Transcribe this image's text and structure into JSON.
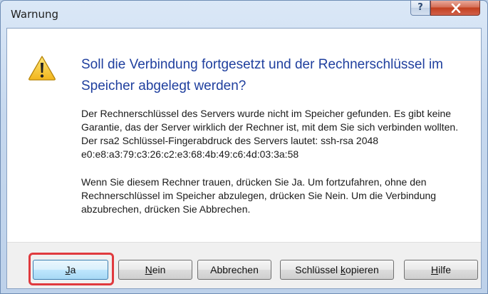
{
  "window": {
    "title": "Warnung",
    "help_glyph": "?"
  },
  "dialog": {
    "heading": "Soll die Verbindung fortgesetzt und der Rechnerschlüssel im Speicher abgelegt werden?",
    "paragraph1": "Der Rechnerschlüssel des Servers wurde nicht im Speicher gefunden. Es gibt keine Garantie, das der Server wirklich der Rechner ist, mit dem Sie sich verbinden wollten. Der rsa2 Schlüssel-Fingerabdruck des Servers lautet: ssh-rsa 2048 e0:e8:a3:79:c3:26:c2:e3:68:4b:49:c6:4d:03:3a:58",
    "paragraph2": "Wenn Sie diesem Rechner trauen, drücken Sie Ja. Um fortzufahren, ohne den Rechnerschlüssel im Speicher abzulegen, drücken Sie Nein. Um die Verbindung abzubrechen, drücken Sie Abbrechen.",
    "icon": "warning-icon"
  },
  "buttons": {
    "yes": {
      "mnemonic": "J",
      "rest": "a"
    },
    "no": {
      "mnemonic": "N",
      "rest": "ein"
    },
    "cancel": {
      "label": "Abbrechen"
    },
    "copy": {
      "before": "Schlüssel ",
      "mnemonic": "k",
      "after": "opieren"
    },
    "help": {
      "mnemonic": "H",
      "rest": "ilfe"
    }
  },
  "colors": {
    "heading": "#1f3f9e",
    "highlight": "#e03a3e",
    "close_button": "#c2401f"
  }
}
